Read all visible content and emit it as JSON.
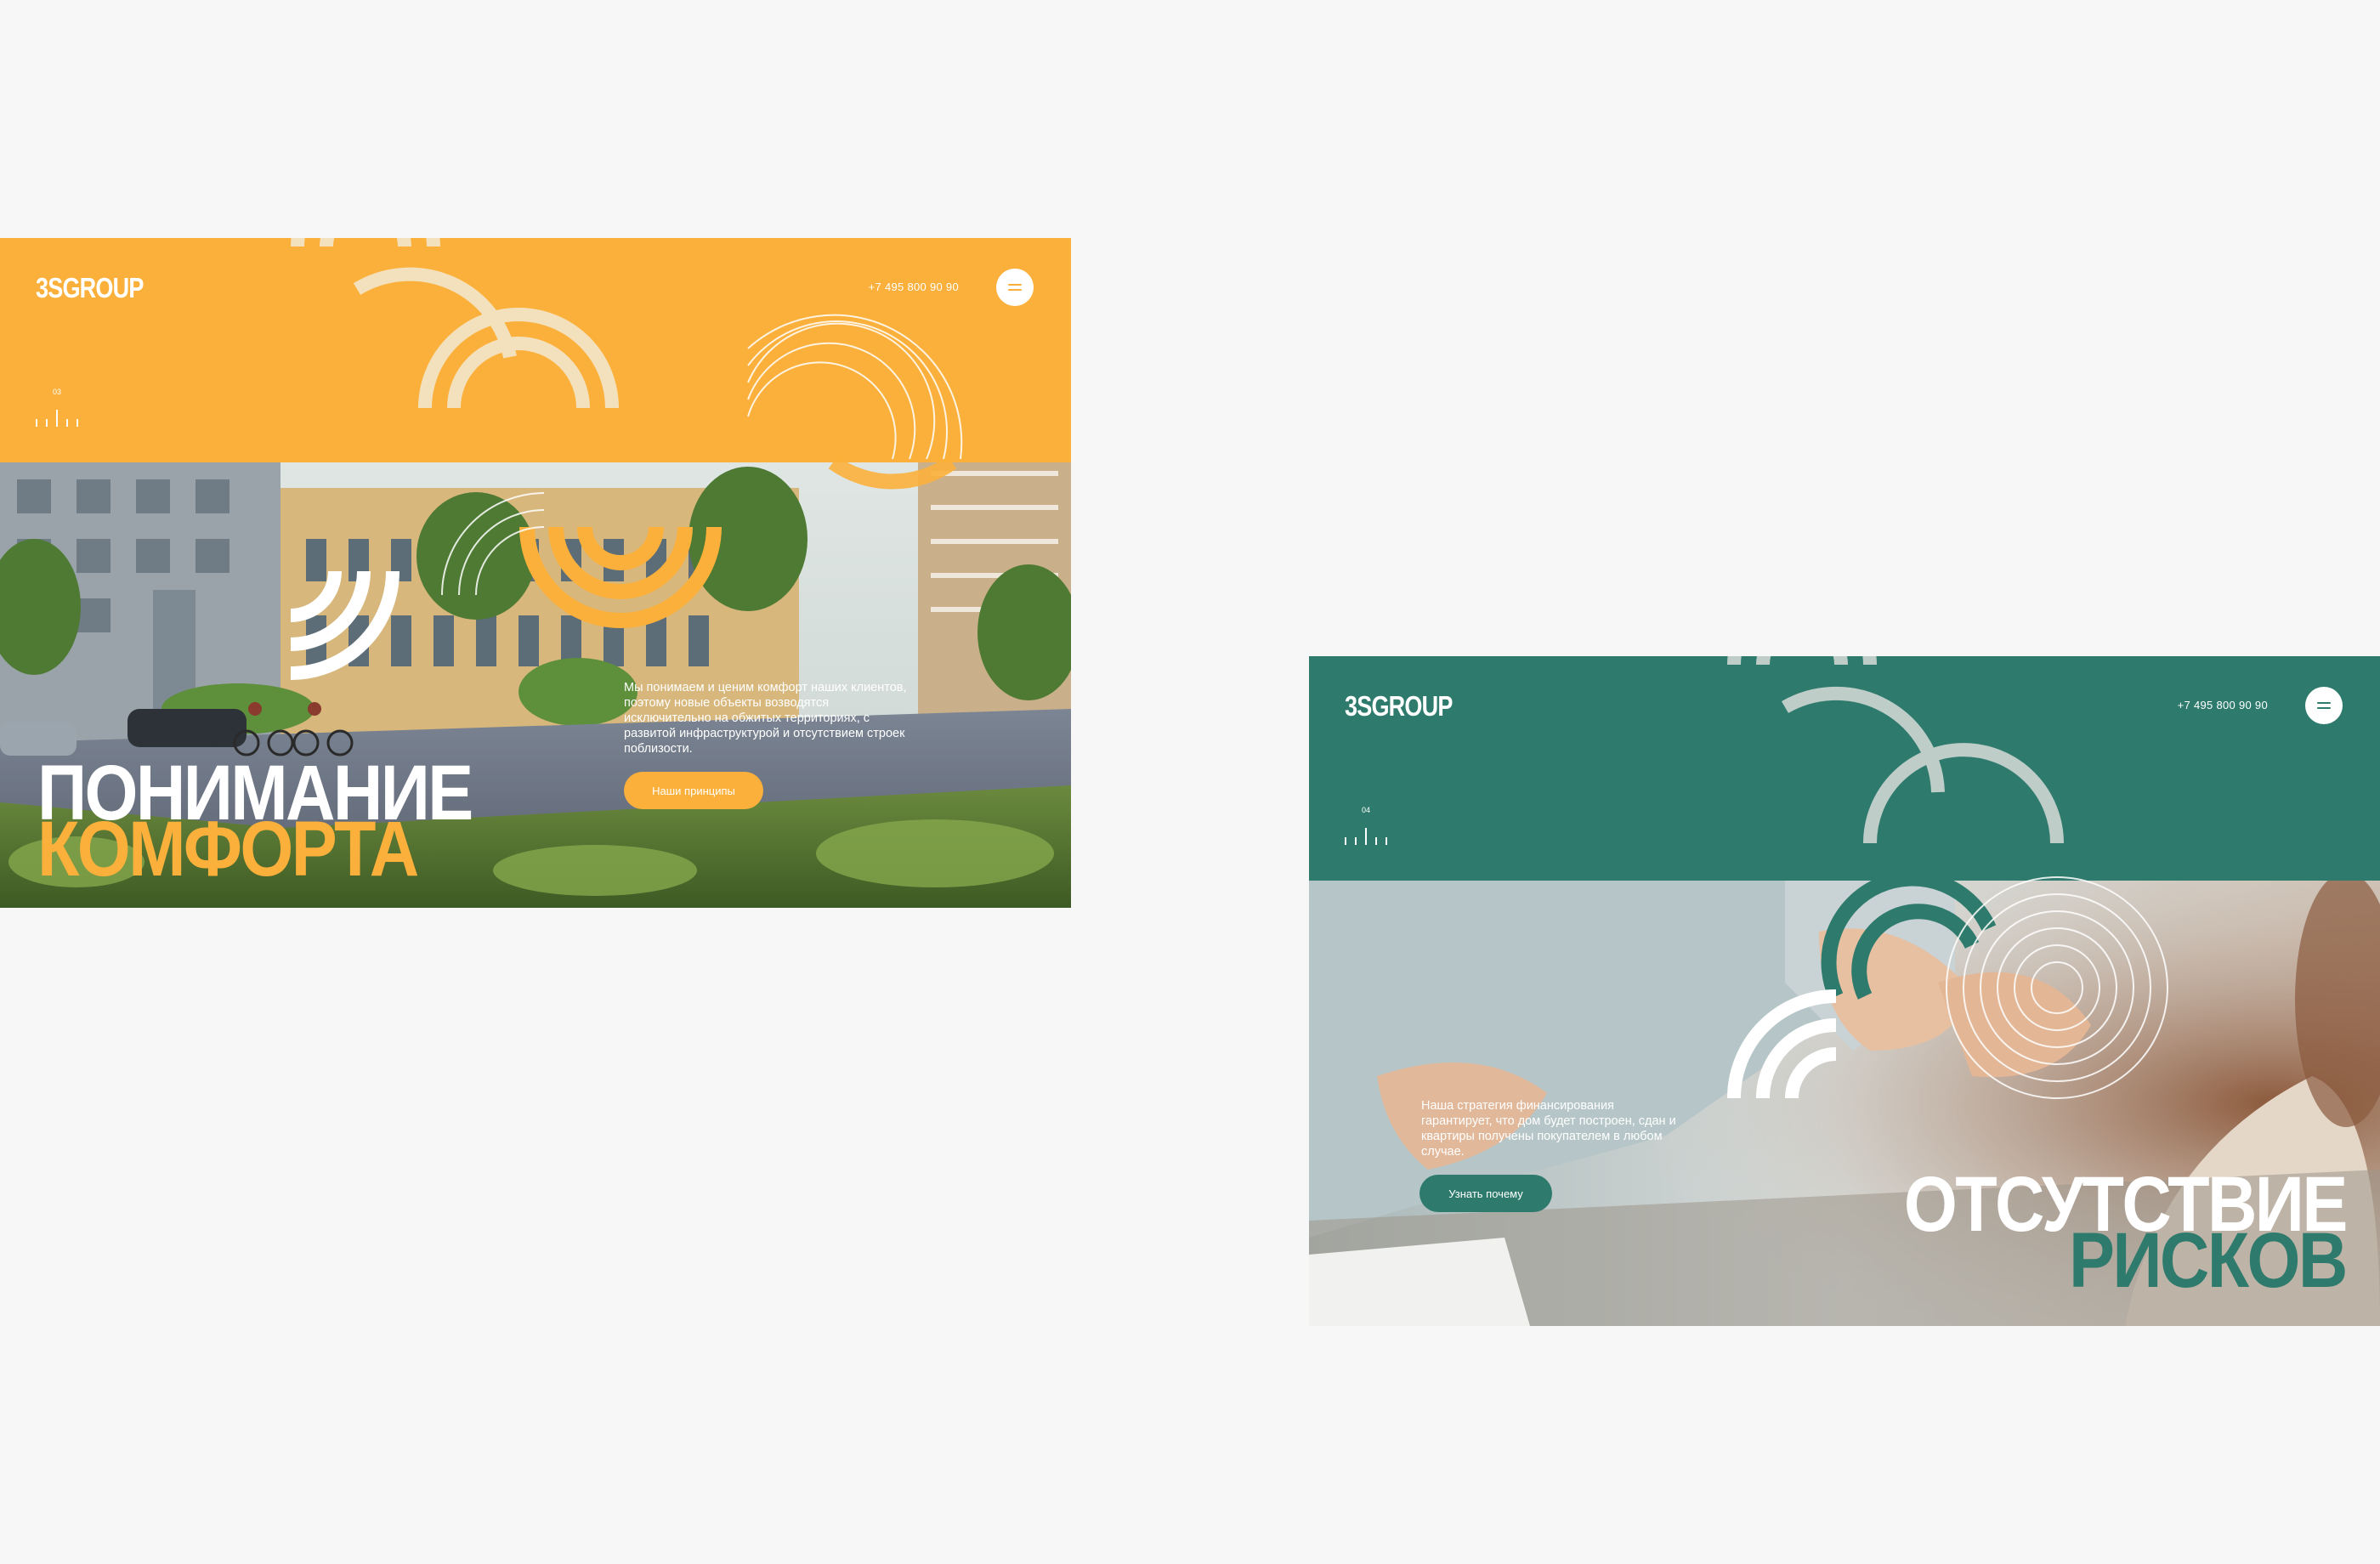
{
  "mockups": [
    {
      "logo": "3SGROUP",
      "phone": "+7 495 800 90 90",
      "slide_number": "03",
      "title_line1": "ПОНИМАНИЕ",
      "title_line2": "КОМФОРТА",
      "description": "Мы понимаем и ценим комфорт наших клиентов, поэтому новые объекты возводятся исключительно на обжитых территориях, с развитой инфраструктурой и отсутствием строек поблизости.",
      "cta_label": "Наши принципы",
      "accent_color": "#fbb03b",
      "photo_subject": "residential street with buildings and cyclists"
    },
    {
      "logo": "3SGROUP",
      "phone": "+7 495 800 90 90",
      "slide_number": "04",
      "title_line1": "ОТСУТСТВИЕ",
      "title_line2": "РИСКОВ",
      "description": "Наша стратегия финансирования гарантирует, что дом будет построен, сдан и квартиры получены покупателем в любом случае.",
      "cta_label": "Узнать почему",
      "accent_color": "#2e7b6d",
      "photo_subject": "business handshake at a table"
    }
  ]
}
